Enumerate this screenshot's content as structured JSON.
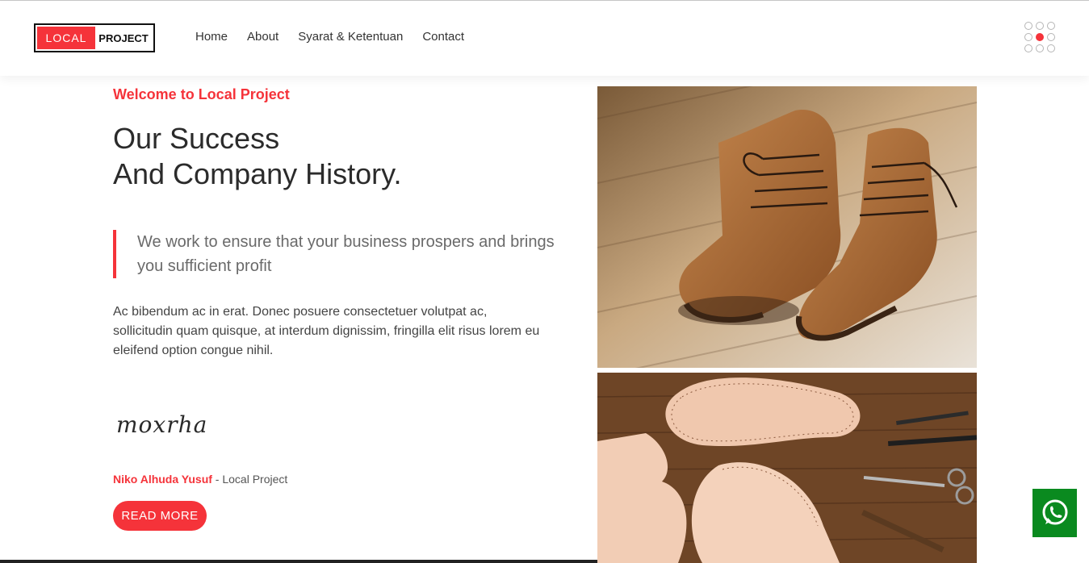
{
  "brand": {
    "logo_left": "LOCAL",
    "logo_right": "PROJECT",
    "accent_color": "#f5333a"
  },
  "nav": {
    "items": [
      "Home",
      "About",
      "Syarat & Ketentuan",
      "Contact"
    ]
  },
  "menu_icon": "grid-dots-icon",
  "hero": {
    "welcome": "Welcome to Local Project",
    "title_line1": "Our Success",
    "title_line2": "And Company History.",
    "quote": "We work to ensure that your business prospers and brings you sufficient profit",
    "paragraph": "Ac bibendum ac in erat. Donec posuere consectetuer volutpat ac, sollicitudin quam quisque, at interdum dignissim, fringilla elit risus lorem eu eleifend option congue nihil.",
    "signature": "moxrha",
    "author_name": "Niko Alhuda Yusuf",
    "author_company": " - Local Project",
    "button_label": "READ MORE"
  },
  "images": {
    "top": "leather-boots-image",
    "bottom": "leather-patterns-image"
  },
  "whatsapp": {
    "icon": "whatsapp-icon",
    "color": "#0a8a1f"
  }
}
